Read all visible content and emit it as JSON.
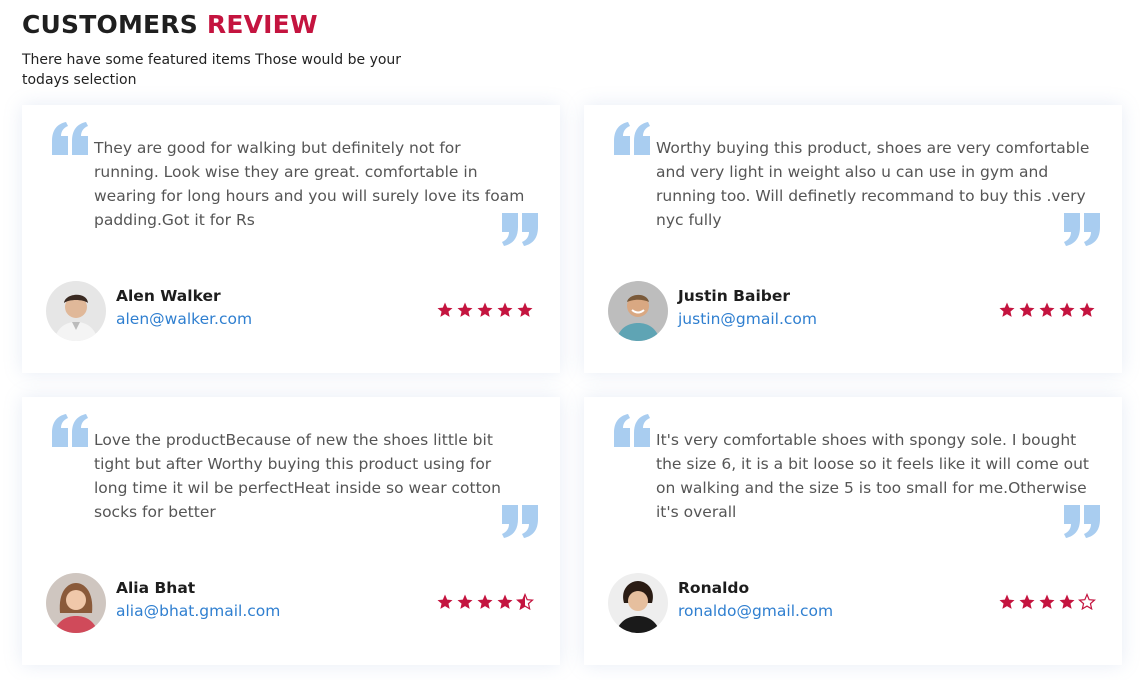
{
  "header": {
    "title_dark": "CUSTOMERS",
    "title_accent": "REVIEW",
    "subtitle": "There have some featured items Those would be your todays selection"
  },
  "colors": {
    "accent": "#c4143f",
    "quote": "#a9cdf0",
    "email": "#2f7fd0",
    "star": "#c4143f"
  },
  "reviews": [
    {
      "text": "They are good for walking but definitely not for running. Look wise they are great. comfortable in wearing for long hours and you will surely love its foam padding.Got it for Rs",
      "name": "Alen Walker",
      "email": "alen@walker.com",
      "rating": 5,
      "avatar_icon": "man-portrait-avatar"
    },
    {
      "text": "Worthy buying this product, shoes are very comfortable and very light in weight also u can use in gym and running too. Will definetly recommand to buy this .very nyc fully",
      "name": "Justin Baiber",
      "email": "justin@gmail.com",
      "rating": 5,
      "avatar_icon": "man-smiling-avatar"
    },
    {
      "text": "Love the productBecause of new the shoes little bit tight but after Worthy buying this product using for long time it wil be perfectHeat inside so wear cotton socks for better",
      "name": "Alia Bhat",
      "email": "alia@bhat.gmail.com",
      "rating": 4.5,
      "avatar_icon": "woman-portrait-avatar"
    },
    {
      "text": "It's very comfortable shoes with spongy sole. I bought the size 6, it is a bit loose so it feels like it will come out on walking and the size 5 is too small for me.Otherwise it's overall",
      "name": "Ronaldo",
      "email": "ronaldo@gmail.com",
      "rating": 4,
      "avatar_icon": "man-curly-hair-avatar"
    }
  ]
}
